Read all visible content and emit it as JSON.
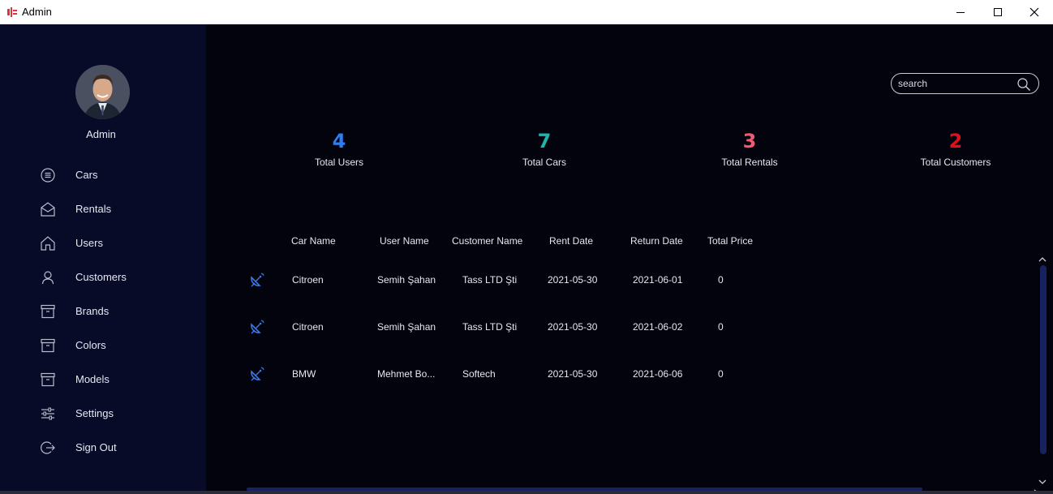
{
  "window": {
    "title": "Admin",
    "icon": "app-logo-icon"
  },
  "colors": {
    "users": "#2f7df2",
    "cars": "#1fb4ac",
    "rentals": "#f05a72",
    "customers": "#e0101c",
    "sidebar": "#070b27",
    "main": "#02030c"
  },
  "profile": {
    "name": "Admin"
  },
  "nav": [
    {
      "label": "Cars",
      "icon": "list-icon"
    },
    {
      "label": "Rentals",
      "icon": "mail-icon"
    },
    {
      "label": "Users",
      "icon": "home-icon"
    },
    {
      "label": "Customers",
      "icon": "person-icon"
    },
    {
      "label": "Brands",
      "icon": "archive-icon"
    },
    {
      "label": "Colors",
      "icon": "archive-icon"
    },
    {
      "label": "Models",
      "icon": "archive-icon"
    },
    {
      "label": "Settings",
      "icon": "sliders-icon"
    },
    {
      "label": "Sign Out",
      "icon": "sign-out-icon"
    }
  ],
  "search": {
    "placeholder": "search",
    "value": ""
  },
  "stats": [
    {
      "value": "4",
      "label": "Total Users"
    },
    {
      "value": "7",
      "label": "Total Cars"
    },
    {
      "value": "3",
      "label": "Total Rentals"
    },
    {
      "value": "2",
      "label": "Total Customers"
    }
  ],
  "table": {
    "columns": [
      "Car Name",
      "User Name",
      "Customer Name",
      "Rent Date",
      "Return Date",
      "Total Price"
    ],
    "rows": [
      {
        "icon": "satellite-dish-icon",
        "car": "Citroen",
        "user": "Semih Şahan",
        "customer": "Tass LTD Şti",
        "rent": "2021-05-30",
        "return": "2021-06-01",
        "price": "0"
      },
      {
        "icon": "satellite-dish-icon",
        "car": "Citroen",
        "user": "Semih Şahan",
        "customer": "Tass LTD Şti",
        "rent": "2021-05-30",
        "return": "2021-06-02",
        "price": "0"
      },
      {
        "icon": "satellite-dish-icon",
        "car": "BMW",
        "user": "Mehmet Bo...",
        "customer": "Softech",
        "rent": "2021-05-30",
        "return": "2021-06-06",
        "price": "0"
      }
    ]
  }
}
